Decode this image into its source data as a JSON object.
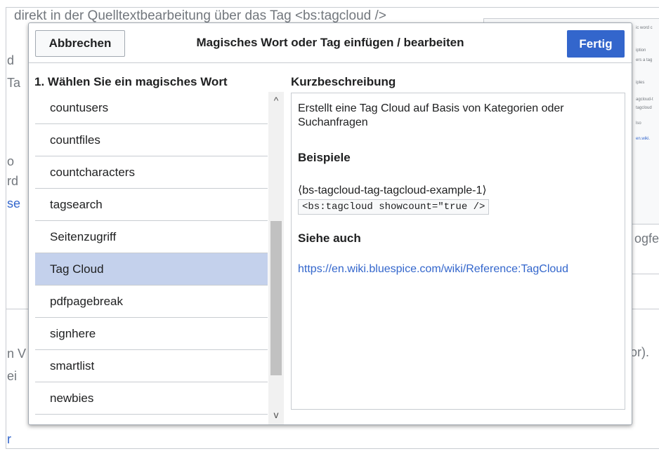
{
  "background": {
    "top_text": "direkt in der Quelltextbearbeitung über das Tag <bs:tagcloud />",
    "side_fragments": [
      "d",
      "Ta",
      "o",
      "rd",
      "se",
      "n V",
      "ei",
      "r"
    ],
    "right_panel_lines": [
      "ic word c",
      "iption",
      "ers a tag",
      "iples",
      "agcloud-t",
      "tagcloud",
      "lso",
      "en.wiki."
    ],
    "right_input_text": "ogfe",
    "right_text": "or)."
  },
  "dialog": {
    "title": "Magisches Wort oder Tag einfügen / bearbeiten",
    "cancel_label": "Abbrechen",
    "done_label": "Fertig"
  },
  "left": {
    "heading": "1. Wählen Sie ein magisches Wort",
    "items": [
      {
        "label": "countusers"
      },
      {
        "label": "countfiles"
      },
      {
        "label": "countcharacters"
      },
      {
        "label": "tagsearch"
      },
      {
        "label": "Seitenzugriff"
      },
      {
        "label": "Tag Cloud",
        "selected": true
      },
      {
        "label": "pdfpagebreak"
      },
      {
        "label": "signhere"
      },
      {
        "label": "smartlist"
      },
      {
        "label": "newbies"
      }
    ],
    "scroll_up_glyph": "^",
    "scroll_down_glyph": "v"
  },
  "right": {
    "heading": "Kurzbeschreibung",
    "description": "Erstellt eine Tag Cloud auf Basis von Kategorien oder Suchanfragen",
    "examples_heading": "Beispiele",
    "example_label": "⟨bs-tagcloud-tag-tagcloud-example-1⟩",
    "example_code": "<bs:tagcloud showcount=\"true />",
    "see_also_heading": "Siehe auch",
    "see_also_link": "https://en.wiki.bluespice.com/wiki/Reference:TagCloud"
  },
  "colors": {
    "accent": "#3366cc",
    "selected_row": "#c4d1ec",
    "border": "#c8ccd1"
  }
}
